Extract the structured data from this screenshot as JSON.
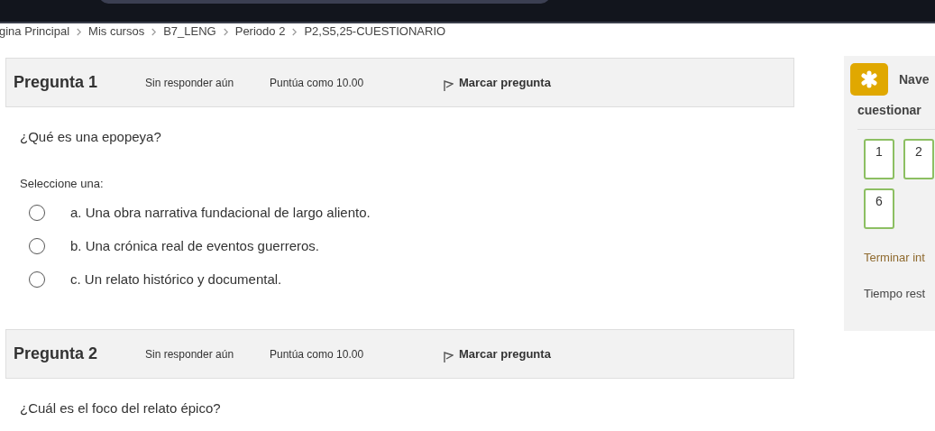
{
  "breadcrumb": [
    "gina Principal",
    "Mis cursos",
    "B7_LENG",
    "Periodo 2",
    "P2,S5,25-CUESTIONARIO"
  ],
  "questions": [
    {
      "title": "Pregunta 1",
      "status": "Sin responder aún",
      "grade": "Puntúa como 10.00",
      "flag": "Marcar pregunta",
      "flagged": false,
      "text": "¿Qué es una epopeya?",
      "prompt": "Seleccione una:",
      "options": [
        {
          "label": "a. Una obra narrativa fundacional de largo aliento.",
          "selected": false
        },
        {
          "label": "b. Una crónica real de eventos guerreros.",
          "selected": false
        },
        {
          "label": "c. Un relato histórico y documental.",
          "selected": false
        }
      ]
    },
    {
      "title": "Pregunta 2",
      "status": "Sin responder aún",
      "grade": "Puntúa como 10.00",
      "flag": "Marcar pregunta",
      "flagged": false,
      "text": "¿Cuál es el foco del relato épico?"
    }
  ],
  "navigation": {
    "title_line_1": "Nave",
    "title_line_2": "cuestionar",
    "buttons": [
      {
        "label": "1",
        "answered": false
      },
      {
        "label": "2",
        "answered": false
      },
      {
        "label": "6",
        "answered": false
      }
    ],
    "finish_link": "Terminar int",
    "timer_label": "Tiempo rest"
  }
}
